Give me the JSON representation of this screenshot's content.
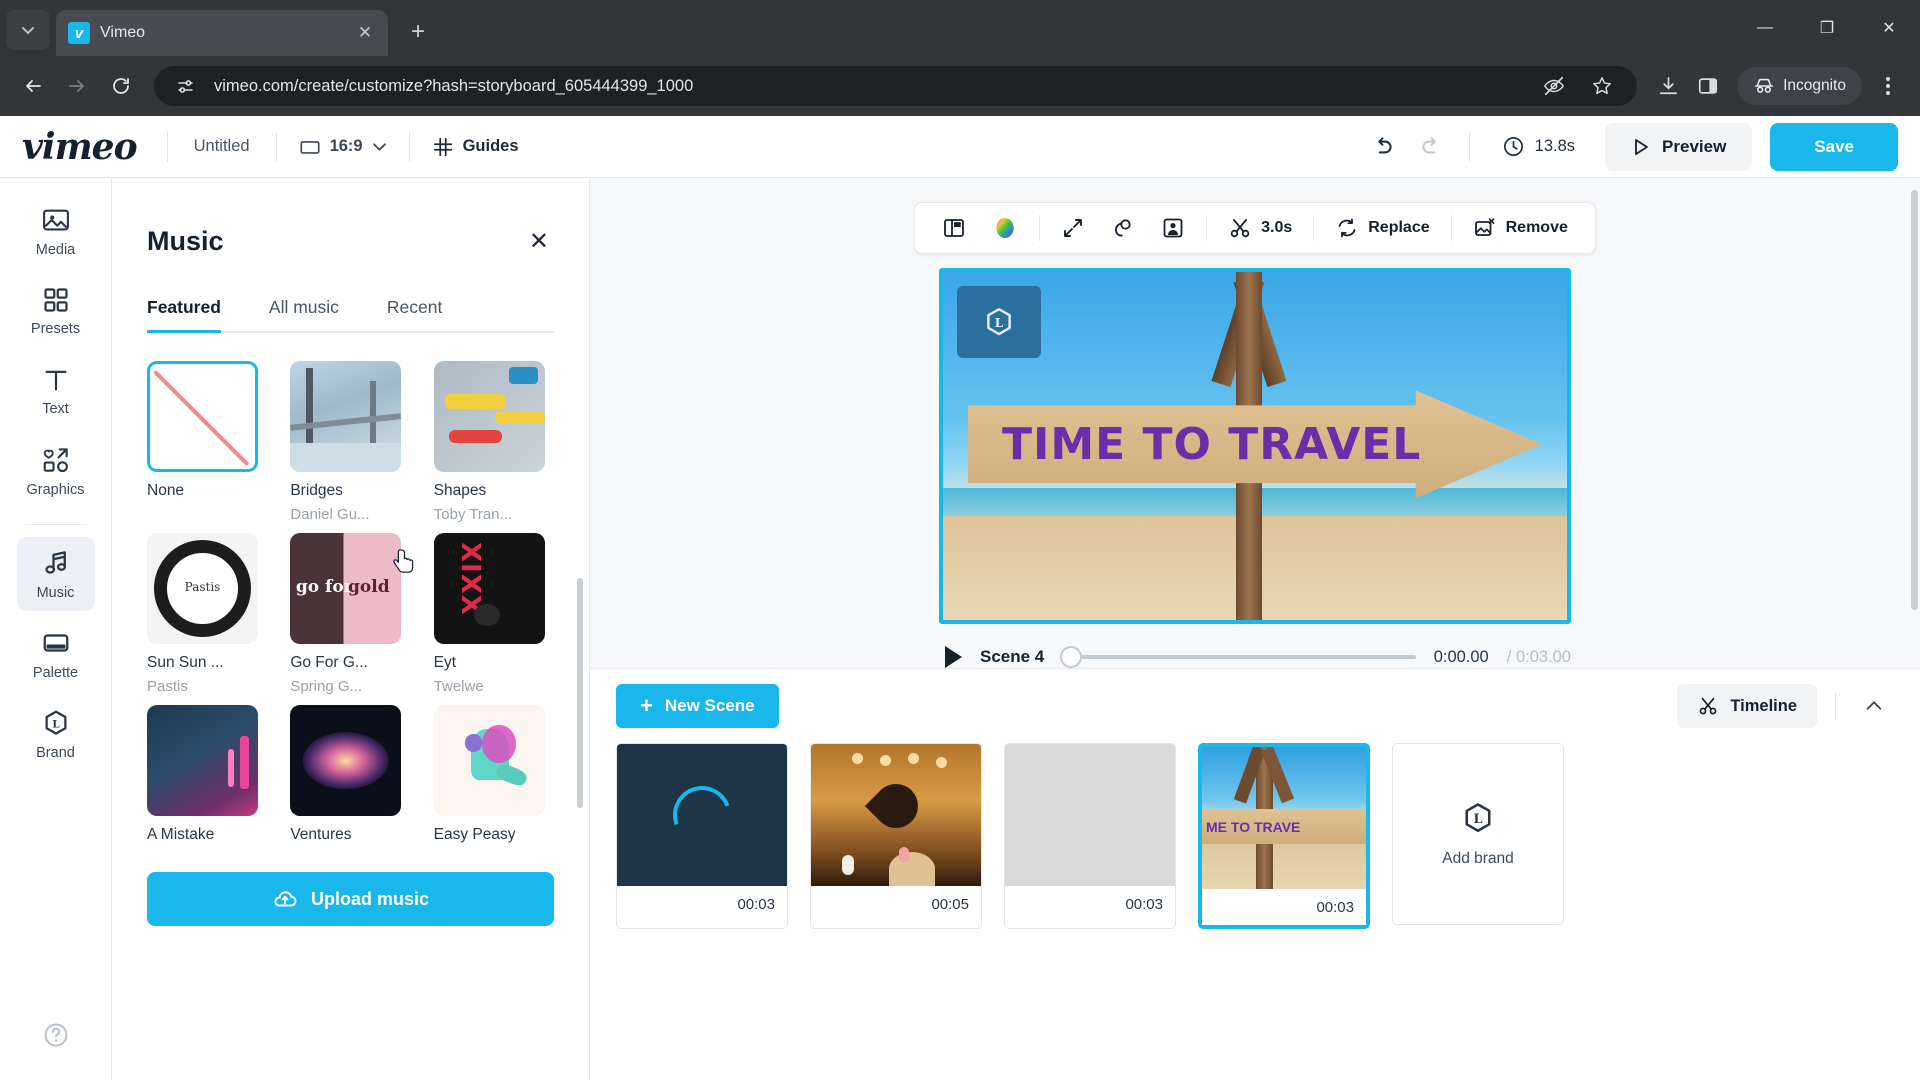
{
  "browser": {
    "tab": {
      "title": "Vimeo",
      "favicon_letter": "v",
      "close_icon": "close-icon"
    },
    "new_tab_label": "+",
    "url": "vimeo.com/create/customize?hash=storyboard_605444399_1000",
    "profile_label": "Incognito",
    "window_controls": {
      "minimize": "—",
      "maximize": "❐",
      "close": "✕"
    }
  },
  "header": {
    "logo": "vimeo",
    "project_name": "Untitled",
    "aspect_ratio": "16:9",
    "guides_label": "Guides",
    "duration": "13.8s",
    "preview_label": "Preview",
    "save_label": "Save"
  },
  "rail": {
    "items": [
      {
        "label": "Media",
        "icon": "image-icon"
      },
      {
        "label": "Presets",
        "icon": "grid-icon"
      },
      {
        "label": "Text",
        "icon": "text-icon"
      },
      {
        "label": "Graphics",
        "icon": "graphics-icon"
      },
      {
        "label": "Music",
        "icon": "music-note-icon",
        "active": true
      },
      {
        "label": "Palette",
        "icon": "palette-icon"
      },
      {
        "label": "Brand",
        "icon": "brand-hex-icon"
      }
    ],
    "help_icon": "help-circle-icon"
  },
  "music_panel": {
    "title": "Music",
    "close_icon": "close-icon",
    "tabs": [
      {
        "label": "Featured",
        "active": true
      },
      {
        "label": "All music",
        "active": false
      },
      {
        "label": "Recent",
        "active": false
      }
    ],
    "tracks": [
      {
        "name": "None",
        "artist": "",
        "selected": true
      },
      {
        "name": "Bridges",
        "artist": "Daniel Gu..."
      },
      {
        "name": "Shapes",
        "artist": "Toby Tran..."
      },
      {
        "name": "Sun Sun ...",
        "artist": "Pastis"
      },
      {
        "name": "Go For G...",
        "artist": "Spring G..."
      },
      {
        "name": "Eyt",
        "artist": "Twelwe"
      },
      {
        "name": "A Mistake",
        "artist": ""
      },
      {
        "name": "Ventures",
        "artist": ""
      },
      {
        "name": "Easy Peasy",
        "artist": ""
      }
    ],
    "upload_label": "Upload music"
  },
  "context_toolbar": {
    "items": [
      {
        "label": "",
        "icon": "layout-icon"
      },
      {
        "label": "",
        "icon": "color-wheel-icon"
      },
      {
        "label": "",
        "icon": "resize-icon"
      },
      {
        "label": "",
        "icon": "link-icon"
      },
      {
        "label": "",
        "icon": "focus-subject-icon"
      },
      {
        "label": "3.0s",
        "icon": "scissors-icon"
      },
      {
        "label": "Replace",
        "icon": "refresh-icon"
      },
      {
        "label": "Remove",
        "icon": "image-remove-icon"
      }
    ]
  },
  "canvas": {
    "sign_text": "TIME TO TRAVEL",
    "brand_badge_icon": "brand-hex-icon"
  },
  "player": {
    "play_icon": "play-icon",
    "scene_label": "Scene 4",
    "current_time": "0:00.00",
    "separator": "/",
    "total_time": "0:03.00",
    "progress_percent": 0
  },
  "timeline": {
    "new_scene_label": "New Scene",
    "timeline_label": "Timeline",
    "collapse_icon": "chevron-up-icon",
    "scenes": [
      {
        "duration": "00:03",
        "kind": "loading",
        "selected": false
      },
      {
        "duration": "00:05",
        "kind": "photo-hands-heart",
        "selected": false
      },
      {
        "duration": "00:03",
        "kind": "blank",
        "selected": false
      },
      {
        "duration": "00:03",
        "kind": "photo-sign",
        "selected": true,
        "overlay_text": "ME TO TRAVE"
      }
    ],
    "add_brand": {
      "label": "Add brand",
      "icon": "brand-hex-icon"
    }
  },
  "colors": {
    "accent": "#1ab7ea",
    "chrome_bg": "#323639",
    "omnibox_bg": "#202124",
    "text_dark": "#16212e"
  }
}
